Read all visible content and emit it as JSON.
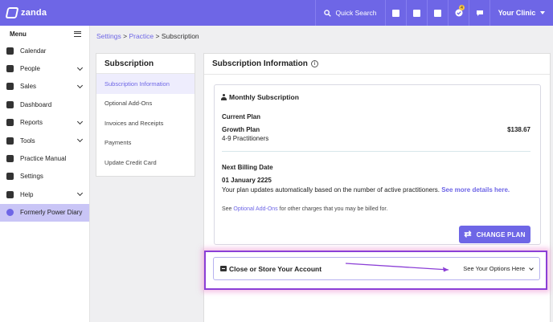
{
  "app": {
    "logo_text": "zanda"
  },
  "topbar": {
    "search_label": "Quick Search",
    "notification_count": "4",
    "clinic_label": "Your Clinic",
    "accent_color": "#6e66e6",
    "icons": [
      "search-icon",
      "contacts-icon",
      "clipboard-icon",
      "calendar-icon",
      "tasks-icon",
      "chat-icon",
      "chevron-down-icon"
    ]
  },
  "sidebar": {
    "menu_label": "Menu",
    "items": [
      {
        "label": "Calendar",
        "icon": "calendar-icon"
      },
      {
        "label": "People",
        "icon": "people-icon"
      },
      {
        "label": "Sales",
        "icon": "sales-icon"
      },
      {
        "label": "Dashboard",
        "icon": "dashboard-icon"
      },
      {
        "label": "Reports",
        "icon": "reports-icon"
      },
      {
        "label": "Tools",
        "icon": "tools-icon"
      },
      {
        "label": "Practice Manual",
        "icon": "book-icon"
      },
      {
        "label": "Settings",
        "icon": "gear-icon"
      },
      {
        "label": "Help",
        "icon": "help-icon"
      },
      {
        "label": "Formerly Power Diary",
        "icon": "power-diary-icon"
      }
    ]
  },
  "breadcrumb": {
    "settings": "Settings",
    "sep": ">",
    "practice": "Practice",
    "current": "Subscription"
  },
  "subnav": {
    "title": "Subscription",
    "items": [
      "Subscription Information",
      "Optional Add-Ons",
      "Invoices and Receipts",
      "Payments",
      "Update Credit Card"
    ]
  },
  "main": {
    "title": "Subscription Information",
    "monthly": {
      "title": "Monthly Subscription",
      "current_plan_label": "Current Plan",
      "plan_name": "Growth Plan",
      "plan_price": "$138.67",
      "plan_range": "4-9 Practitioners",
      "billing_label": "Next Billing Date",
      "billing_date": "01 January 2225",
      "billing_note": "Your plan updates automatically based on the number of active practitioners.",
      "details_link": "See more details here.",
      "addons_prefix": "See",
      "addons_link": "Optional Add-Ons",
      "addons_suffix": "for other charges that you may be billed for.",
      "change_plan": "CHANGE PLAN"
    },
    "close_store": {
      "title": "Close or Store Your Account",
      "options_label": "See Your Options Here"
    }
  }
}
